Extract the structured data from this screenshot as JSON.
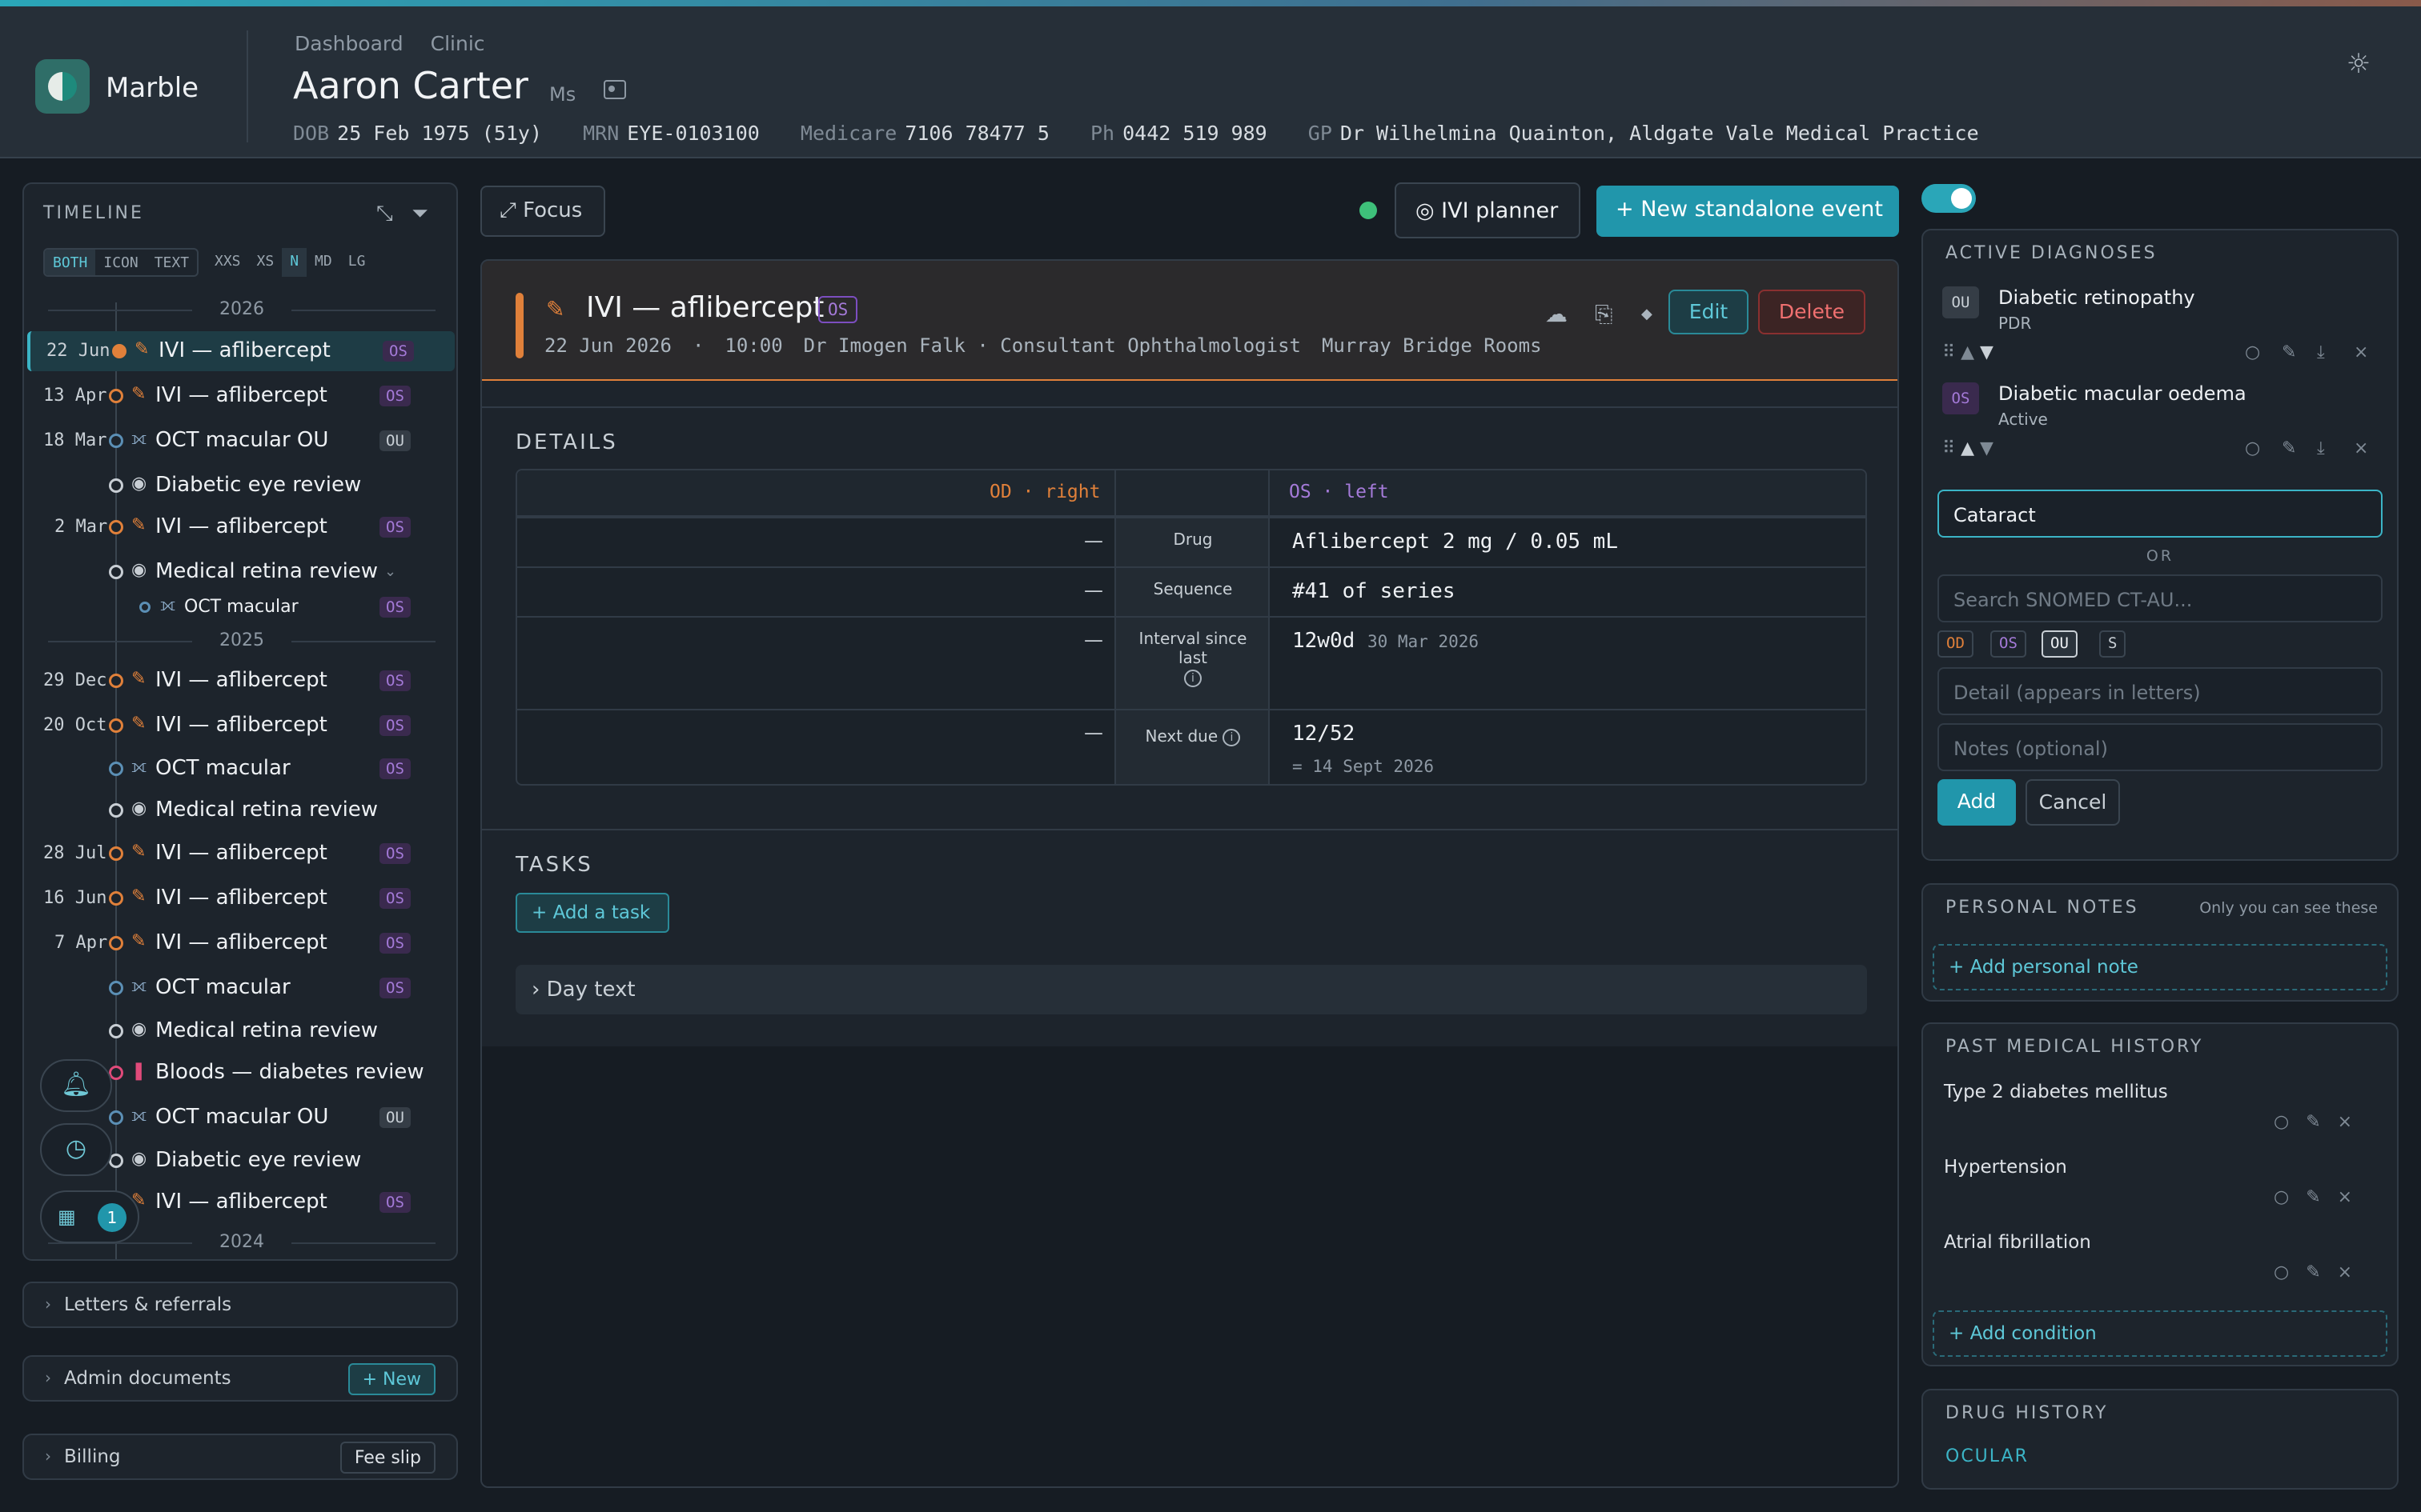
{
  "header": {
    "brand": "Marble",
    "crumb1": "Dashboard",
    "crumb2": "Clinic",
    "patient_name": "Aaron Carter",
    "patient_title": "Ms",
    "dob_k": "DOB",
    "dob_v": "25 Feb 1975 (51y)",
    "mrn_k": "MRN",
    "mrn_v": "EYE-0103100",
    "medicare_k": "Medicare",
    "medicare_v": "7106 78477 5",
    "ph_k": "Ph",
    "ph_v": "0442 519 989",
    "gp_k": "GP",
    "gp_v": "Dr Wilhelmina Quainton, Aldgate Vale Medical Practice"
  },
  "timeline": {
    "title": "TIMELINE",
    "modes": [
      "BOTH",
      "ICON",
      "TEXT"
    ],
    "sizes": [
      "XXS",
      "XS",
      "N",
      "MD",
      "LG"
    ],
    "years": [
      "2026",
      "2025",
      "2024"
    ],
    "items": [
      {
        "date": "22 Jun",
        "label": "IVI — aflibercept",
        "badge": "OS"
      },
      {
        "date": "13 Apr",
        "label": "IVI — aflibercept",
        "badge": "OS"
      },
      {
        "date": "18 Mar",
        "label": "OCT macular OU",
        "badge": "OU"
      },
      {
        "date": "",
        "label": "Diabetic eye review",
        "badge": ""
      },
      {
        "date": "2 Mar",
        "label": "IVI — aflibercept",
        "badge": "OS"
      },
      {
        "date": "",
        "label": "Medical retina review",
        "badge": ""
      },
      {
        "date": "",
        "label": "OCT macular",
        "badge": "OS"
      },
      {
        "date": "29 Dec",
        "label": "IVI — aflibercept",
        "badge": "OS"
      },
      {
        "date": "20 Oct",
        "label": "IVI — aflibercept",
        "badge": "OS"
      },
      {
        "date": "",
        "label": "OCT macular",
        "badge": "OS"
      },
      {
        "date": "",
        "label": "Medical retina review",
        "badge": ""
      },
      {
        "date": "28 Jul",
        "label": "IVI — aflibercept",
        "badge": "OS"
      },
      {
        "date": "16 Jun",
        "label": "IVI — aflibercept",
        "badge": "OS"
      },
      {
        "date": "7 Apr",
        "label": "IVI — aflibercept",
        "badge": "OS"
      },
      {
        "date": "",
        "label": "OCT macular",
        "badge": "OS"
      },
      {
        "date": "",
        "label": "Medical retina review",
        "badge": ""
      },
      {
        "date": "",
        "label": "Bloods — diabetes review",
        "badge": ""
      },
      {
        "date": "",
        "label": "OCT macular OU",
        "badge": "OU"
      },
      {
        "date": "",
        "label": "Diabetic eye review",
        "badge": ""
      },
      {
        "date": "",
        "label": "IVI — aflibercept",
        "badge": "OS"
      }
    ],
    "calendar_count": "1"
  },
  "accordions": {
    "letters": "Letters & referrals",
    "admin": "Admin documents",
    "admin_btn": "+ New",
    "billing": "Billing",
    "billing_btn": "Fee slip"
  },
  "toolbar": {
    "focus": "⤢ Focus",
    "ivi_planner": "◎ IVI planner",
    "new_event": "+ New standalone event"
  },
  "event": {
    "title": "IVI — aflibercept",
    "eye": "OS",
    "date": "22 Jun 2026",
    "time": "10:00",
    "clinician": "Dr Imogen Falk · Consultant Ophthalmologist",
    "location": "Murray Bridge Rooms",
    "edit": "Edit",
    "delete": "Delete"
  },
  "details": {
    "title": "DETAILS",
    "od": "OD · right",
    "os": "OS · left",
    "rows": [
      {
        "k": "Drug",
        "od": "—",
        "os": "Aflibercept 2 mg / 0.05 mL",
        "extra": ""
      },
      {
        "k": "Sequence",
        "od": "—",
        "os": "#41 of series",
        "extra": ""
      },
      {
        "k": "Interval since last",
        "od": "—",
        "os": "12w0d",
        "extra": "30 Mar 2026"
      },
      {
        "k": "Next due",
        "od": "—",
        "os": "12/52",
        "extra": "= 14 Sept 2026"
      }
    ]
  },
  "tasks": {
    "title": "TASKS",
    "add": "+ Add a task",
    "day_text": "› Day text"
  },
  "diagnoses": {
    "title": "ACTIVE DIAGNOSES",
    "items": [
      {
        "eye": "OU",
        "name": "Diabetic retinopathy",
        "status": "PDR"
      },
      {
        "eye": "OS",
        "name": "Diabetic macular oedema",
        "status": "Active"
      }
    ],
    "input_value": "Cataract",
    "or": "OR",
    "search_placeholder": "Search SNOMED CT-AU...",
    "eyes": [
      "OD",
      "OS",
      "OU",
      "S"
    ],
    "detail_placeholder": "Detail (appears in letters)",
    "notes_placeholder": "Notes (optional)",
    "add": "Add",
    "cancel": "Cancel"
  },
  "personal_notes": {
    "title": "PERSONAL NOTES",
    "hint": "Only you can see these",
    "add": "+ Add personal note"
  },
  "pmh": {
    "title": "PAST MEDICAL HISTORY",
    "items": [
      "Type 2 diabetes mellitus",
      "Hypertension",
      "Atrial fibrillation"
    ],
    "add": "+ Add condition"
  },
  "drug_history": {
    "title": "DRUG HISTORY",
    "sub": "OCULAR"
  },
  "colors": {
    "accent": "#2196ab",
    "od": "#e0803a",
    "os": "#a47ad8",
    "danger": "#f07070"
  }
}
